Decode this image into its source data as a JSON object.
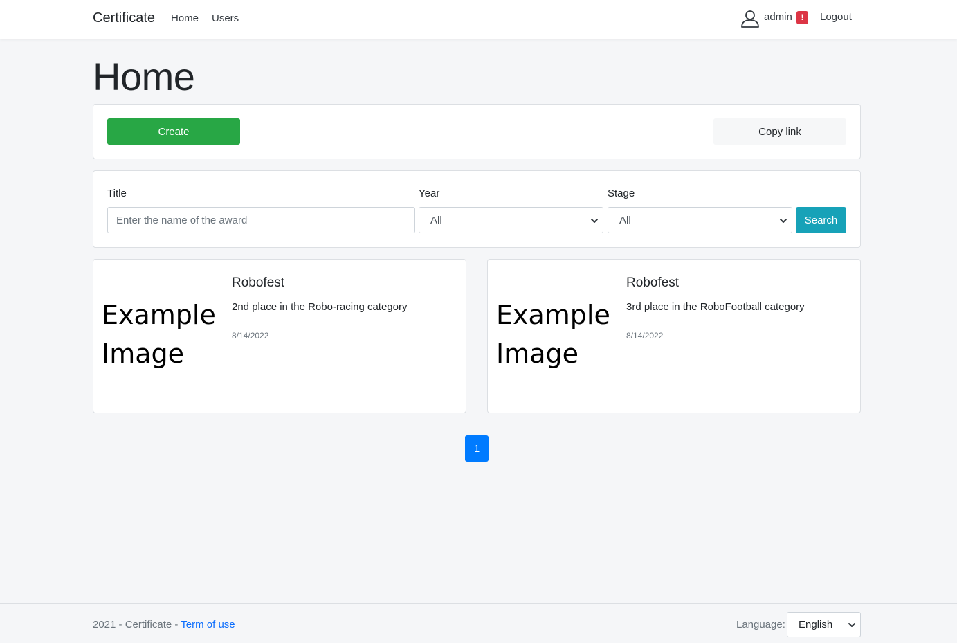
{
  "navbar": {
    "brand": "Certificate",
    "links": [
      "Home",
      "Users"
    ],
    "user_icon": "user-icon",
    "username": "admin",
    "alert_badge": "!",
    "logout": "Logout"
  },
  "page": {
    "title": "Home"
  },
  "actions": {
    "create_label": "Create",
    "copy_link_label": "Copy link",
    "create_color": "#28a745"
  },
  "filters": {
    "title_label": "Title",
    "title_placeholder": "Enter the name of the award",
    "year_label": "Year",
    "year_value": "All",
    "stage_label": "Stage",
    "stage_value": "All",
    "search_label": "Search",
    "search_color": "#17a2b8"
  },
  "cards": [
    {
      "image_text_1": "Example",
      "image_text_2": "Image",
      "title": "Robofest",
      "description": "2nd place in the Robo-racing category",
      "date": "8/14/2022"
    },
    {
      "image_text_1": "Example",
      "image_text_2": "Image",
      "title": "Robofest",
      "description": "3rd place in the RoboFootball category",
      "date": "8/14/2022"
    }
  ],
  "pagination": {
    "current_page": "1",
    "color": "#007bff"
  },
  "footer": {
    "text": "2021 - Certificate - ",
    "term_link": "Term of use",
    "language_label": "Language:",
    "language_value": "English"
  }
}
